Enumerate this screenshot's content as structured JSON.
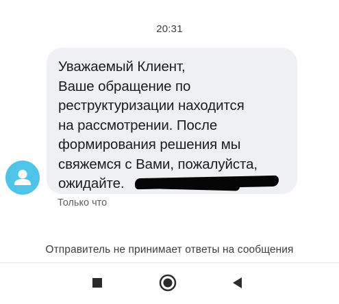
{
  "status": {
    "time": "20:31"
  },
  "conversation": {
    "message": {
      "text": "Уважаемый Клиент,\nВаше обращение по\nреструктуризации находится\nна рассмотрении. После\nформирования решения мы\nсвяжемся с Вами, пожалуйста,\nожидайте.",
      "sent_status": "Только что"
    },
    "sender_avatar": {
      "icon": "person-icon",
      "color": "#4fc3e8"
    },
    "no_reply_notice": "Отправитель не принимает ответы на сообщения"
  },
  "nav_bar": {
    "recents_icon": "square-icon",
    "home_icon": "circle-home-icon",
    "back_icon": "triangle-back-icon"
  }
}
